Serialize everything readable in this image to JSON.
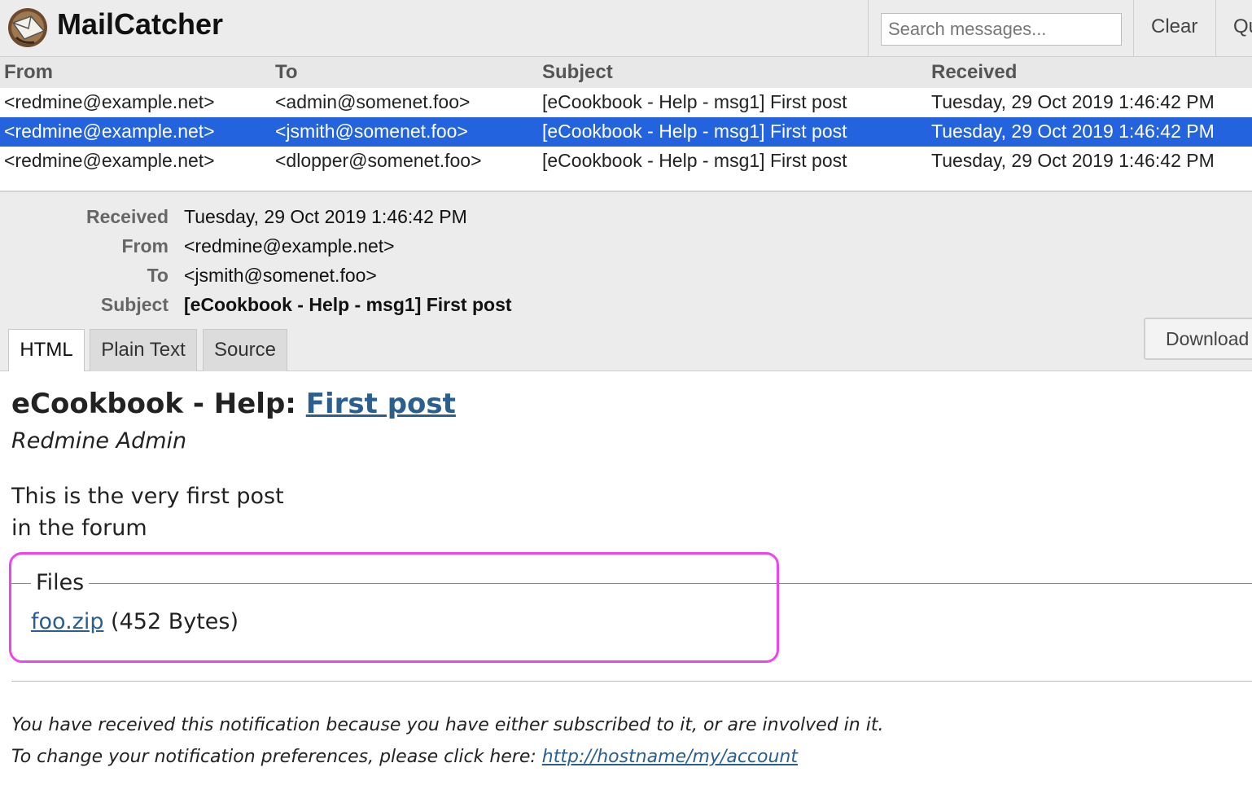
{
  "app": {
    "title": "MailCatcher"
  },
  "header": {
    "search_placeholder": "Search messages...",
    "clear_label": "Clear",
    "quit_label": "Qu"
  },
  "list": {
    "columns": [
      "From",
      "To",
      "Subject",
      "Received"
    ],
    "rows": [
      {
        "from": "<redmine@example.net>",
        "to": "<admin@somenet.foo>",
        "subject": "[eCookbook - Help - msg1] First post",
        "received": "Tuesday, 29 Oct 2019 1:46:42 PM",
        "selected": false
      },
      {
        "from": "<redmine@example.net>",
        "to": "<jsmith@somenet.foo>",
        "subject": "[eCookbook - Help - msg1] First post",
        "received": "Tuesday, 29 Oct 2019 1:46:42 PM",
        "selected": true
      },
      {
        "from": "<redmine@example.net>",
        "to": "<dlopper@somenet.foo>",
        "subject": "[eCookbook - Help - msg1] First post",
        "received": "Tuesday, 29 Oct 2019 1:46:42 PM",
        "selected": false
      }
    ],
    "selected_color": "#2463de"
  },
  "details": {
    "received_label": "Received",
    "received_value": "Tuesday, 29 Oct 2019 1:46:42 PM",
    "from_label": "From",
    "from_value": "<redmine@example.net>",
    "to_label": "To",
    "to_value": "<jsmith@somenet.foo>",
    "subject_label": "Subject",
    "subject_value": "[eCookbook - Help - msg1] First post",
    "tabs": [
      "HTML",
      "Plain Text",
      "Source"
    ],
    "active_tab": "HTML",
    "download_label": "Download"
  },
  "body": {
    "title_prefix": "eCookbook - Help: ",
    "title_link": "First post",
    "author": "Redmine Admin",
    "post_lines": [
      "This is the very first post",
      "in the forum"
    ],
    "files_legend": "Files",
    "file_name": "foo.zip",
    "file_size": " (452 Bytes)",
    "footer_line1": "You have received this notification because you have either subscribed to it, or are involved in it.",
    "footer_line2_prefix": "To change your notification preferences, please click here: ",
    "footer_link": "http://hostname/my/account",
    "link_color": "#2a5f8f",
    "highlight_color": "#ee44ee"
  }
}
